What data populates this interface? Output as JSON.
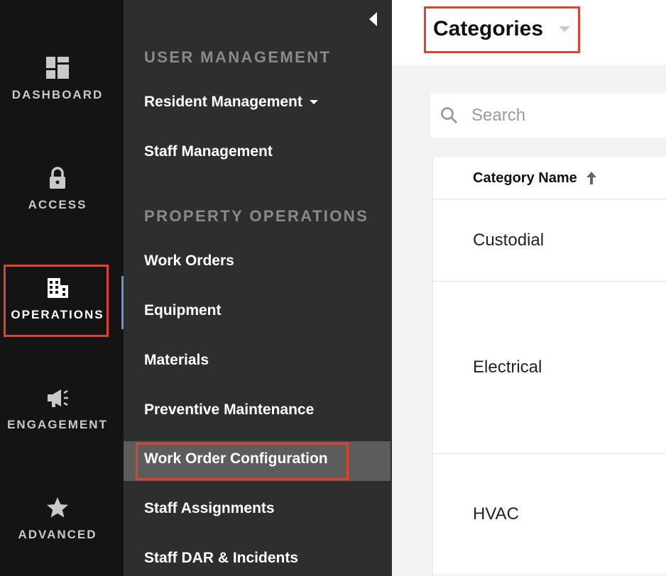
{
  "rail": {
    "items": [
      {
        "label": "DASHBOARD",
        "icon": "dashboard-icon"
      },
      {
        "label": "ACCESS",
        "icon": "lock-icon"
      },
      {
        "label": "OPERATIONS",
        "icon": "building-icon"
      },
      {
        "label": "ENGAGEMENT",
        "icon": "megaphone-icon"
      },
      {
        "label": "ADVANCED",
        "icon": "star-icon"
      }
    ],
    "active": "OPERATIONS"
  },
  "submenu": {
    "sections": [
      {
        "header": "USER MANAGEMENT"
      },
      {
        "header": "PROPERTY OPERATIONS"
      }
    ],
    "items": [
      {
        "label": "Resident Management"
      },
      {
        "label": "Staff Management"
      },
      {
        "label": "Work Orders"
      },
      {
        "label": "Equipment"
      },
      {
        "label": "Materials"
      },
      {
        "label": "Preventive Maintenance"
      },
      {
        "label": "Work Order Configuration"
      },
      {
        "label": "Staff Assignments"
      },
      {
        "label": "Staff DAR & Incidents"
      }
    ]
  },
  "main": {
    "title": "Categories",
    "search_placeholder": "Search",
    "table": {
      "column_header": "Category Name",
      "rows": [
        "Custodial",
        "Electrical",
        "HVAC"
      ]
    }
  },
  "colors": {
    "highlight": "#e0432b",
    "rail_bg": "#141414",
    "submenu_bg": "#2e2e2e",
    "active_row_bg": "#5c5c5c",
    "indicator": "#6a93d8"
  }
}
